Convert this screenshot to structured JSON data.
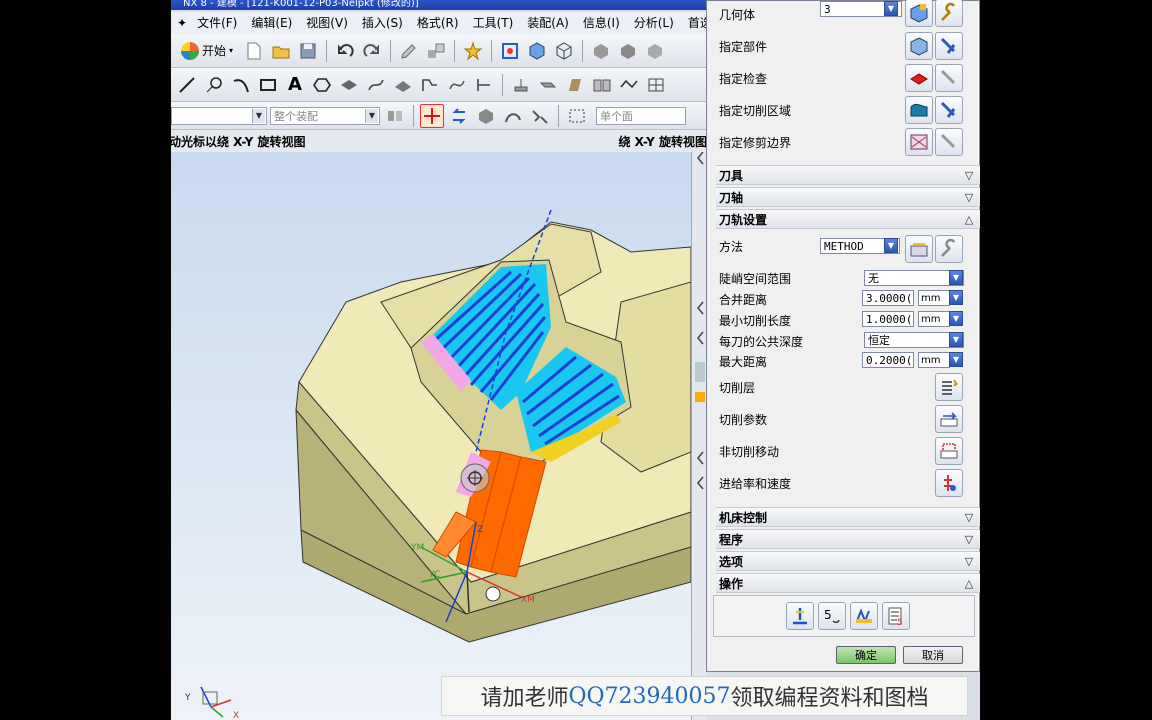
{
  "window": {
    "title": "NX 8 - 建模 - [121-K001-12-P03-Nelpkt (修改的)]"
  },
  "menubar": [
    "文件(F)",
    "编辑(E)",
    "视图(V)",
    "插入(S)",
    "格式(R)",
    "工具(T)",
    "装配(A)",
    "信息(I)",
    "分析(L)",
    "首选项(P)"
  ],
  "toolbar": {
    "start_label": "开始",
    "filter_label": "",
    "scope_label": "整个装配",
    "face_label": "单个面"
  },
  "viewport": {
    "left_hint": "拖动光标以绕 X-Y 旋转视图",
    "right_hint": "绕 X-Y 旋转视图"
  },
  "dialog": {
    "geometry": {
      "label": "几何体",
      "value": "3",
      "rows": [
        {
          "label": "指定部件"
        },
        {
          "label": "指定检查"
        },
        {
          "label": "指定切削区域"
        },
        {
          "label": "指定修剪边界"
        }
      ]
    },
    "sections": {
      "tool": "刀具",
      "axis": "刀轴",
      "path_settings": "刀轨设置",
      "machine_control": "机床控制",
      "program": "程序",
      "options": "选项",
      "actions": "操作"
    },
    "path_settings": {
      "method_label": "方法",
      "method_value": "METHOD",
      "steep_label": "陡峭空间范围",
      "steep_value": "无",
      "merge_label": "合并距离",
      "merge_value": "3.0000(",
      "merge_unit": "mm",
      "min_cut_label": "最小切削长度",
      "min_cut_value": "1.0000(",
      "min_cut_unit": "mm",
      "depth_label": "每刀的公共深度",
      "depth_value": "恒定",
      "max_dist_label": "最大距离",
      "max_dist_value": "0.2000(",
      "max_dist_unit": "mm",
      "cut_levels_label": "切削层",
      "cut_params_label": "切削参数",
      "non_cut_label": "非切削移动",
      "feeds_label": "进给率和速度"
    },
    "ok_label": "确定",
    "cancel_label": "取消"
  },
  "watermark": {
    "prefix": "请加老师",
    "qq": "QQ723940057",
    "suffix": "领取编程资料和图档"
  },
  "colors": {
    "toolpath_blue": "#1a3fd6",
    "toolpath_cyan": "#19c8f0",
    "tool_orange": "#ff6a00",
    "model_yellow": "#efeab8"
  }
}
